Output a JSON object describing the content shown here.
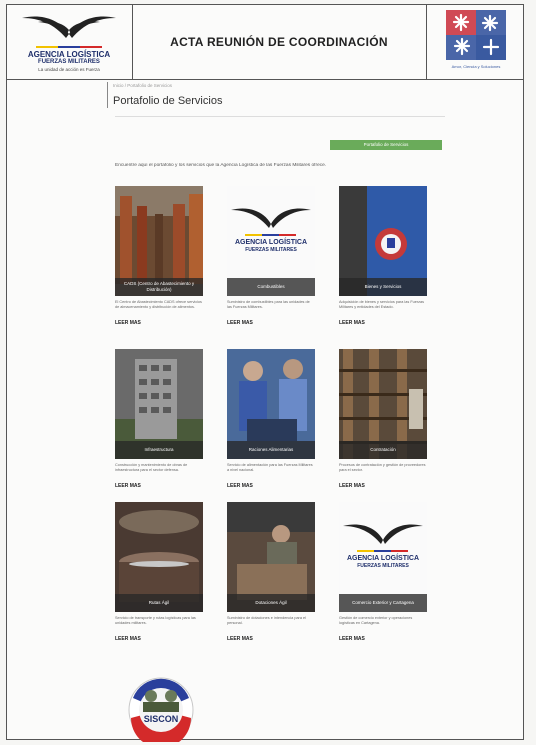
{
  "header": {
    "title": "ACTA REUNIÓN DE COORDINACIÓN",
    "logo_name_line1": "AGENCIA LOGÍSTICA",
    "logo_name_line2": "FUERZAS MILITARES",
    "logo_tagline": "La unidad de acción es Fuerza",
    "right_logo_caption": "Amor, Ciencia y Soluciones"
  },
  "page": {
    "breadcrumb": "Inicio / Portafolio de Servicios",
    "title": "Portafolio de Servicios",
    "green_button": "Portafolio de Servicios",
    "intro": "Encuentre aquí el portafolio y los servicios que la Agencia Logística de las Fuerzas Militares ofrece."
  },
  "cards": [
    {
      "caption": "CADS (Centro de Abastecimiento y Distribución)",
      "text": "El Centro de Abastecimiento CADS ofrece servicios de almacenamiento y distribución de alimentos.",
      "more": "LEER MAS",
      "image": "warehouse"
    },
    {
      "caption": "Combustibles",
      "text": "Suministro de combustibles para las unidades de las Fuerzas Militares.",
      "more": "LEER MAS",
      "image": "logo"
    },
    {
      "caption": "Bienes y Servicios",
      "text": "Adquisición de bienes y servicios para las Fuerzas Militares y entidades del Estado.",
      "more": "LEER MAS",
      "image": "flag"
    },
    {
      "caption": "Infraestructura",
      "text": "Construcción y mantenimiento de obras de infraestructura para el sector defensa.",
      "more": "LEER MAS",
      "image": "building"
    },
    {
      "caption": "Raciones Alimentarias",
      "text": "Servicio de alimentación para las Fuerzas Militares a nivel nacional.",
      "more": "LEER MAS",
      "image": "food"
    },
    {
      "caption": "Contratación",
      "text": "Procesos de contratación y gestión de proveedores para el sector.",
      "more": "LEER MAS",
      "image": "shelves"
    },
    {
      "caption": "Rutas Ágil",
      "text": "Servicio de transporte y rutas logísticas para las unidades militares.",
      "more": "LEER MAS",
      "image": "machine"
    },
    {
      "caption": "Dotaciones Ágil",
      "text": "Suministro de dotaciones e intendencia para el personal.",
      "more": "LEER MAS",
      "image": "workshop"
    },
    {
      "caption": "Comercio Exterior y Cartagena",
      "text": "Gestión de comercio exterior y operaciones logísticas en Cartagena.",
      "more": "LEER MAS",
      "image": "logo"
    }
  ],
  "badge": {
    "label": "SISCON"
  },
  "colors": {
    "navy": "#1f2f6b",
    "green": "#6aab5a",
    "flag_yellow": "#f2c200",
    "flag_blue": "#2a3f9c",
    "flag_red": "#d42a2a"
  }
}
